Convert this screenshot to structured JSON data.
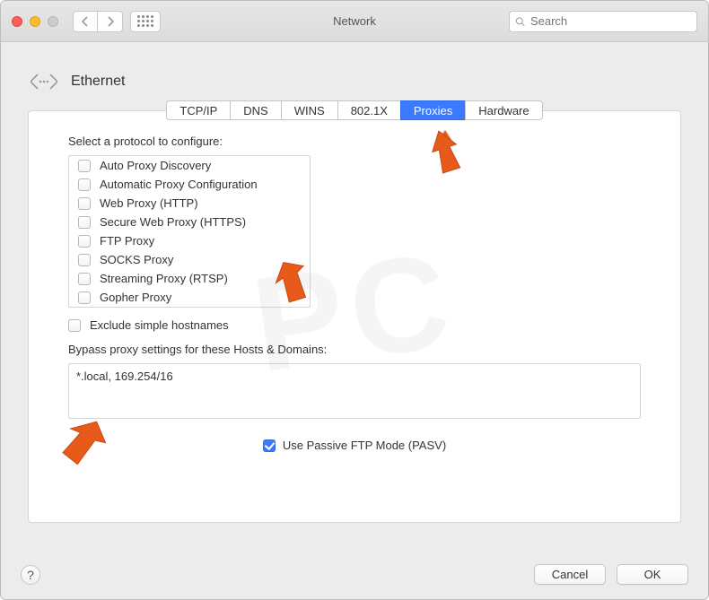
{
  "window": {
    "title": "Network"
  },
  "search": {
    "placeholder": "Search"
  },
  "header": {
    "interface": "Ethernet"
  },
  "tabs": [
    {
      "id": "tcpip",
      "label": "TCP/IP",
      "active": false
    },
    {
      "id": "dns",
      "label": "DNS",
      "active": false
    },
    {
      "id": "wins",
      "label": "WINS",
      "active": false
    },
    {
      "id": "8021x",
      "label": "802.1X",
      "active": false
    },
    {
      "id": "proxies",
      "label": "Proxies",
      "active": true
    },
    {
      "id": "hardware",
      "label": "Hardware",
      "active": false
    }
  ],
  "labels": {
    "select_protocol": "Select a protocol to configure:",
    "exclude_simple": "Exclude simple hostnames",
    "bypass_title": "Bypass proxy settings for these Hosts & Domains:",
    "pasv": "Use Passive FTP Mode (PASV)"
  },
  "protocols": [
    {
      "label": "Auto Proxy Discovery",
      "checked": false
    },
    {
      "label": "Automatic Proxy Configuration",
      "checked": false
    },
    {
      "label": "Web Proxy (HTTP)",
      "checked": false
    },
    {
      "label": "Secure Web Proxy (HTTPS)",
      "checked": false
    },
    {
      "label": "FTP Proxy",
      "checked": false
    },
    {
      "label": "SOCKS Proxy",
      "checked": false
    },
    {
      "label": "Streaming Proxy (RTSP)",
      "checked": false
    },
    {
      "label": "Gopher Proxy",
      "checked": false
    }
  ],
  "exclude_simple_checked": false,
  "bypass_value": "*.local, 169.254/16",
  "pasv_checked": true,
  "buttons": {
    "help": "?",
    "cancel": "Cancel",
    "ok": "OK"
  }
}
